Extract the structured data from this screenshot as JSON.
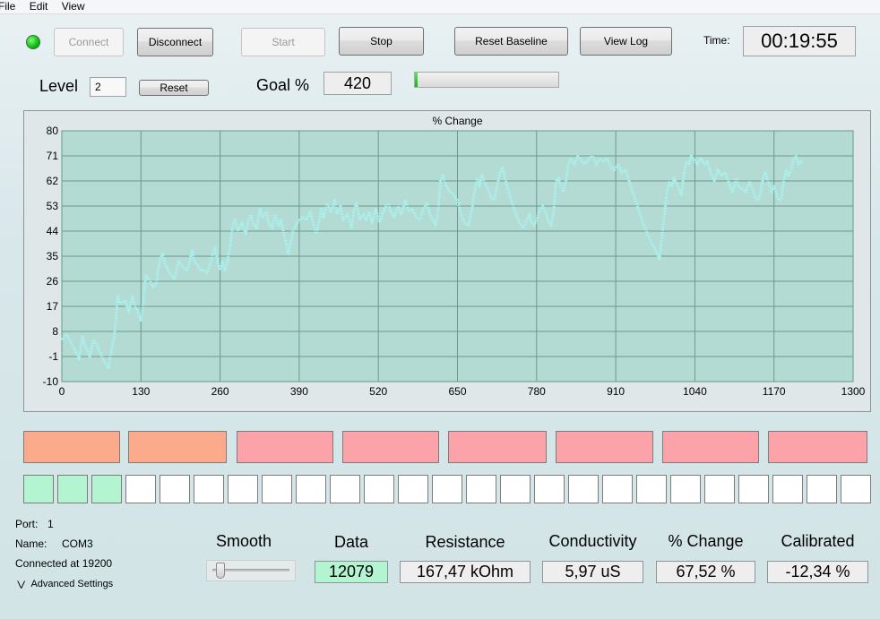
{
  "menu": [
    "File",
    "Edit",
    "View"
  ],
  "buttons": {
    "connect": "Connect",
    "disconnect": "Disconnect",
    "start": "Start",
    "stop": "Stop",
    "reset_baseline": "Reset Baseline",
    "view_log": "View Log",
    "reset": "Reset"
  },
  "time": {
    "label": "Time:",
    "value": "00:19:55"
  },
  "level": {
    "label": "Level",
    "value": "2"
  },
  "goal": {
    "label": "Goal %",
    "value": "420",
    "progress_fraction": 0.02
  },
  "chart_data": {
    "type": "line",
    "title": "% Change",
    "xlim": [
      0,
      1300
    ],
    "ylim": [
      -10,
      80
    ],
    "xticks": [
      0,
      130,
      260,
      390,
      520,
      650,
      780,
      910,
      1040,
      1170,
      1300
    ],
    "yticks": [
      -10,
      -1,
      8,
      17,
      26,
      35,
      44,
      53,
      62,
      71,
      80
    ],
    "grid": true,
    "series": [
      {
        "color": "#aaf0ee",
        "points": [
          [
            0,
            5
          ],
          [
            8,
            7
          ],
          [
            15,
            4
          ],
          [
            22,
            1
          ],
          [
            28,
            -2
          ],
          [
            34,
            6
          ],
          [
            40,
            2
          ],
          [
            46,
            -1
          ],
          [
            52,
            5
          ],
          [
            58,
            3
          ],
          [
            62,
            1
          ],
          [
            70,
            -3
          ],
          [
            77,
            -5
          ],
          [
            82,
            2
          ],
          [
            86,
            6
          ],
          [
            90,
            15
          ],
          [
            92,
            21
          ],
          [
            96,
            18
          ],
          [
            104,
            19
          ],
          [
            110,
            15
          ],
          [
            116,
            21
          ],
          [
            120,
            17
          ],
          [
            125,
            15
          ],
          [
            130,
            12
          ],
          [
            134,
            19
          ],
          [
            138,
            28
          ],
          [
            142,
            27
          ],
          [
            150,
            24
          ],
          [
            155,
            25
          ],
          [
            158,
            30
          ],
          [
            162,
            34
          ],
          [
            166,
            36
          ],
          [
            170,
            32
          ],
          [
            175,
            30
          ],
          [
            180,
            28
          ],
          [
            185,
            27
          ],
          [
            188,
            30
          ],
          [
            192,
            33
          ],
          [
            196,
            32
          ],
          [
            200,
            31
          ],
          [
            206,
            30
          ],
          [
            210,
            33
          ],
          [
            214,
            37
          ],
          [
            218,
            33
          ],
          [
            222,
            32
          ],
          [
            228,
            30
          ],
          [
            234,
            30
          ],
          [
            238,
            29
          ],
          [
            244,
            32
          ],
          [
            248,
            36
          ],
          [
            252,
            38
          ],
          [
            256,
            33
          ],
          [
            260,
            30
          ],
          [
            264,
            33
          ],
          [
            268,
            30
          ],
          [
            272,
            33
          ],
          [
            276,
            38
          ],
          [
            280,
            45
          ],
          [
            284,
            48
          ],
          [
            290,
            44
          ],
          [
            296,
            47
          ],
          [
            302,
            43
          ],
          [
            306,
            47
          ],
          [
            310,
            50
          ],
          [
            314,
            47
          ],
          [
            320,
            45
          ],
          [
            326,
            52
          ],
          [
            330,
            49
          ],
          [
            336,
            51
          ],
          [
            340,
            47
          ],
          [
            346,
            45
          ],
          [
            350,
            50
          ],
          [
            356,
            46
          ],
          [
            360,
            48
          ],
          [
            366,
            42
          ],
          [
            372,
            36
          ],
          [
            376,
            40
          ],
          [
            380,
            44
          ],
          [
            384,
            46
          ],
          [
            390,
            48
          ],
          [
            396,
            49
          ],
          [
            402,
            48
          ],
          [
            408,
            51
          ],
          [
            414,
            46
          ],
          [
            418,
            43
          ],
          [
            422,
            47
          ],
          [
            426,
            52
          ],
          [
            430,
            49
          ],
          [
            436,
            54
          ],
          [
            442,
            51
          ],
          [
            448,
            55
          ],
          [
            452,
            50
          ],
          [
            458,
            53
          ],
          [
            462,
            48
          ],
          [
            470,
            50
          ],
          [
            476,
            45
          ],
          [
            480,
            52
          ],
          [
            484,
            54
          ],
          [
            490,
            48
          ],
          [
            496,
            50
          ],
          [
            500,
            48
          ],
          [
            505,
            51
          ],
          [
            510,
            47
          ],
          [
            516,
            52
          ],
          [
            522,
            47
          ],
          [
            530,
            52
          ],
          [
            536,
            54
          ],
          [
            540,
            51
          ],
          [
            546,
            49
          ],
          [
            552,
            53
          ],
          [
            558,
            50
          ],
          [
            564,
            55
          ],
          [
            570,
            51
          ],
          [
            576,
            52
          ],
          [
            582,
            49
          ],
          [
            588,
            48
          ],
          [
            594,
            52
          ],
          [
            600,
            54
          ],
          [
            605,
            50
          ],
          [
            610,
            48
          ],
          [
            614,
            46
          ],
          [
            618,
            51
          ],
          [
            622,
            62
          ],
          [
            626,
            64
          ],
          [
            632,
            60
          ],
          [
            638,
            58
          ],
          [
            644,
            57
          ],
          [
            650,
            55
          ],
          [
            656,
            50
          ],
          [
            662,
            47
          ],
          [
            668,
            46
          ],
          [
            674,
            52
          ],
          [
            678,
            58
          ],
          [
            682,
            63
          ],
          [
            686,
            60
          ],
          [
            690,
            64
          ],
          [
            694,
            62
          ],
          [
            700,
            59
          ],
          [
            706,
            56
          ],
          [
            710,
            55
          ],
          [
            716,
            61
          ],
          [
            720,
            65
          ],
          [
            724,
            67
          ],
          [
            728,
            63
          ],
          [
            734,
            58
          ],
          [
            740,
            54
          ],
          [
            746,
            50
          ],
          [
            752,
            47
          ],
          [
            758,
            45
          ],
          [
            764,
            48
          ],
          [
            768,
            50
          ],
          [
            772,
            47
          ],
          [
            776,
            46
          ],
          [
            780,
            48
          ],
          [
            786,
            52
          ],
          [
            790,
            53
          ],
          [
            796,
            50
          ],
          [
            800,
            47
          ],
          [
            804,
            46
          ],
          [
            808,
            51
          ],
          [
            812,
            62
          ],
          [
            816,
            63
          ],
          [
            820,
            60
          ],
          [
            824,
            58
          ],
          [
            828,
            62
          ],
          [
            832,
            68
          ],
          [
            836,
            70
          ],
          [
            842,
            68
          ],
          [
            848,
            71
          ],
          [
            854,
            69
          ],
          [
            860,
            68
          ],
          [
            866,
            70
          ],
          [
            872,
            71
          ],
          [
            878,
            68
          ],
          [
            884,
            70
          ],
          [
            890,
            69
          ],
          [
            896,
            70
          ],
          [
            902,
            67
          ],
          [
            908,
            66
          ],
          [
            914,
            68
          ],
          [
            920,
            65
          ],
          [
            926,
            66
          ],
          [
            932,
            62
          ],
          [
            938,
            58
          ],
          [
            944,
            54
          ],
          [
            950,
            50
          ],
          [
            956,
            46
          ],
          [
            962,
            43
          ],
          [
            968,
            40
          ],
          [
            974,
            38
          ],
          [
            978,
            36
          ],
          [
            982,
            34
          ],
          [
            986,
            42
          ],
          [
            990,
            50
          ],
          [
            994,
            58
          ],
          [
            998,
            62
          ],
          [
            1002,
            60
          ],
          [
            1006,
            63
          ],
          [
            1010,
            61
          ],
          [
            1014,
            59
          ],
          [
            1018,
            57
          ],
          [
            1022,
            65
          ],
          [
            1026,
            69
          ],
          [
            1030,
            68
          ],
          [
            1034,
            71
          ],
          [
            1038,
            70
          ],
          [
            1044,
            68
          ],
          [
            1050,
            70
          ],
          [
            1056,
            68
          ],
          [
            1060,
            69
          ],
          [
            1066,
            65
          ],
          [
            1072,
            62
          ],
          [
            1078,
            66
          ],
          [
            1084,
            64
          ],
          [
            1090,
            65
          ],
          [
            1096,
            61
          ],
          [
            1102,
            58
          ],
          [
            1108,
            63
          ],
          [
            1112,
            60
          ],
          [
            1118,
            59
          ],
          [
            1124,
            58
          ],
          [
            1130,
            62
          ],
          [
            1136,
            58
          ],
          [
            1140,
            56
          ],
          [
            1144,
            55
          ],
          [
            1148,
            58
          ],
          [
            1152,
            63
          ],
          [
            1156,
            65
          ],
          [
            1160,
            62
          ],
          [
            1166,
            58
          ],
          [
            1170,
            60
          ],
          [
            1174,
            57
          ],
          [
            1178,
            55
          ],
          [
            1182,
            56
          ],
          [
            1186,
            62
          ],
          [
            1190,
            66
          ],
          [
            1194,
            64
          ],
          [
            1198,
            66
          ],
          [
            1202,
            70
          ],
          [
            1206,
            71
          ],
          [
            1210,
            68
          ],
          [
            1214,
            69
          ],
          [
            1218,
            68
          ]
        ]
      }
    ]
  },
  "status_tiles": [
    {
      "color": "#fbab8c"
    },
    {
      "color": "#fbab8c"
    },
    {
      "color": "#fca3aa"
    },
    {
      "color": "#fca3aa"
    },
    {
      "color": "#fca3aa"
    },
    {
      "color": "#fca3aa"
    },
    {
      "color": "#fca3aa"
    },
    {
      "color": "#fca3aa"
    }
  ],
  "level_squares": {
    "total": 25,
    "active": 3
  },
  "port_info": {
    "port_label": "Port:",
    "port_value": "1",
    "name_label": "Name:",
    "name_value": "COM3",
    "connected": "Connected at 19200",
    "advanced": "Advanced Settings"
  },
  "smooth": {
    "label": "Smooth",
    "value_fraction": 0.05
  },
  "metrics": [
    {
      "label": "Data",
      "value": "12079"
    },
    {
      "label": "Resistance",
      "value": "167,47 kOhm"
    },
    {
      "label": "Conductivity",
      "value": "5,97 uS"
    },
    {
      "label": "% Change",
      "value": "67,52 %"
    },
    {
      "label": "Calibrated",
      "value": "-12,34 %"
    }
  ],
  "colors": {
    "plot_bg": "#b3dbd3",
    "grid": "#6a9a8a",
    "data_active_bg": "#b3f5d1",
    "led": "#14c214",
    "progress": "#22c522"
  }
}
